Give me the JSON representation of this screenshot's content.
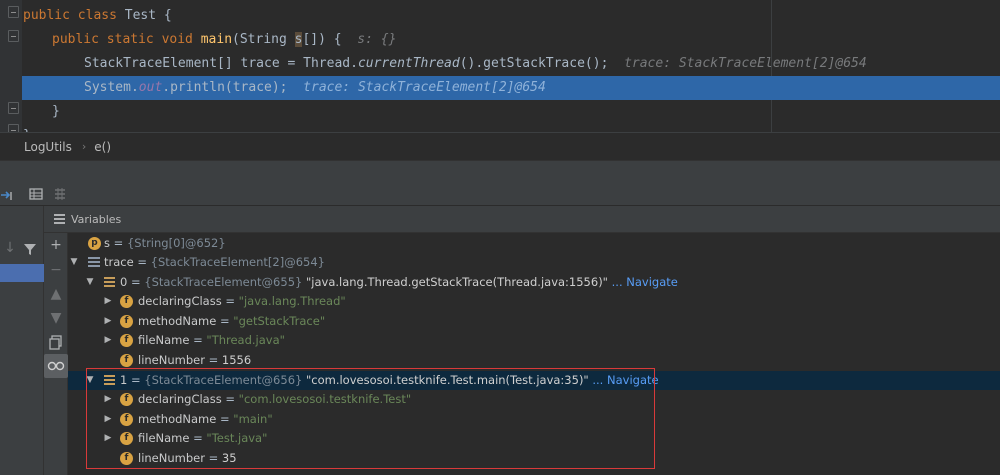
{
  "editor": {
    "lines": [
      {
        "kw": "public class ",
        "rest": "Test {"
      },
      {
        "kw": "public static void ",
        "fn": "main",
        "pre_param": "(String ",
        "param": "s",
        "post_param": "[]) {",
        "hint": "s: {}"
      },
      {
        "text_a": "StackTraceElement[] trace = Thread.",
        "italic": "currentThread",
        "text_b": "().getStackTrace();",
        "hint": "trace: StackTraceElement[2]@654"
      },
      {
        "text_a": "System.",
        "static": "out",
        "text_b": ".println(trace);",
        "hint": "trace: StackTraceElement[2]@654"
      },
      {
        "text": "}"
      },
      {
        "text": "}"
      }
    ]
  },
  "breadcrumb": {
    "class_name": "LogUtils",
    "separator": "›",
    "method": "e()"
  },
  "variables_panel": {
    "title": "Variables",
    "rows": [
      {
        "name": "s",
        "eq": " = ",
        "value": "{String[0]@652}"
      },
      {
        "name": "trace",
        "eq": " = ",
        "value": "{StackTraceElement[2]@654}"
      },
      {
        "name": "0",
        "eq": " = ",
        "type": "{StackTraceElement@655} ",
        "value": "\"java.lang.Thread.getStackTrace(Thread.java:1556)\"",
        "nav": " ... Navigate"
      },
      {
        "name": "declaringClass",
        "eq": " = ",
        "value": "\"java.lang.Thread\""
      },
      {
        "name": "methodName",
        "eq": " = ",
        "value": "\"getStackTrace\""
      },
      {
        "name": "fileName",
        "eq": " = ",
        "value": "\"Thread.java\""
      },
      {
        "name": "lineNumber",
        "eq": " = ",
        "value": "1556"
      },
      {
        "name": "1",
        "eq": " = ",
        "type": "{StackTraceElement@656} ",
        "value": "\"com.lovesosoi.testknife.Test.main(Test.java:35)\"",
        "nav": " ... Navigate"
      },
      {
        "name": "declaringClass",
        "eq": " = ",
        "value": "\"com.lovesosoi.testknife.Test\""
      },
      {
        "name": "methodName",
        "eq": " = ",
        "value": "\"main\""
      },
      {
        "name": "fileName",
        "eq": " = ",
        "value": "\"Test.java\""
      },
      {
        "name": "lineNumber",
        "eq": " = ",
        "value": "35"
      }
    ]
  },
  "icons": {
    "param_badge": "p",
    "field_badge": "f",
    "step_into": "step-icon",
    "table_view": "table-icon",
    "settings": "settings-icon",
    "filter": "filter-icon",
    "add": "plus-icon",
    "copy": "copy-icon",
    "watches": "glasses-icon"
  },
  "colors": {
    "selection": "#2e67a8",
    "highlight_box": "#d93a3a",
    "navigate_link": "#589df6"
  }
}
